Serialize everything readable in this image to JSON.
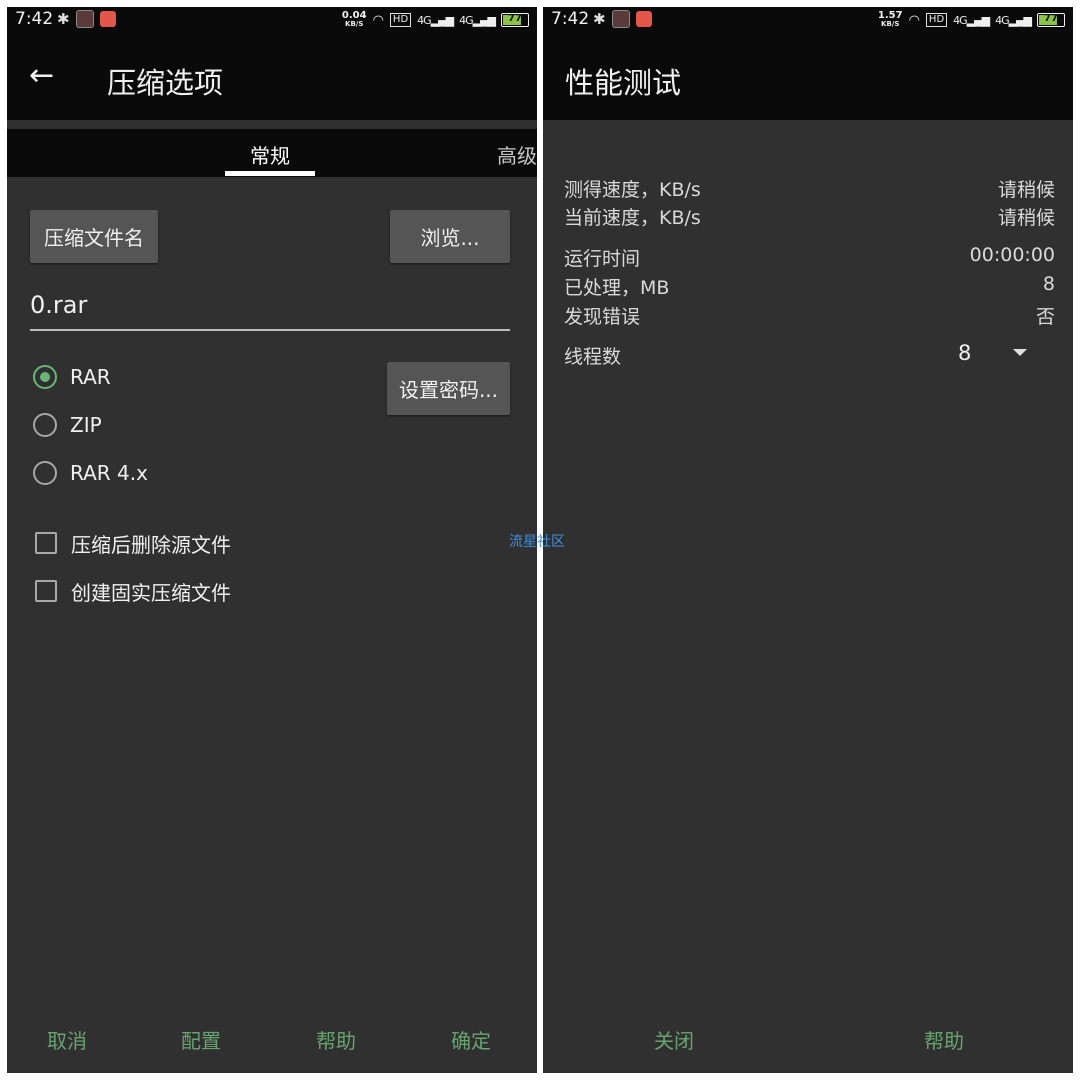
{
  "left": {
    "status": {
      "time": "7:42",
      "net_speed": "0.04",
      "net_unit": "KB/S",
      "sig1": "4G",
      "sig2": "4G",
      "hd": "HD",
      "battery": "77",
      "battery_level": 0.77
    },
    "title": "压缩选项",
    "tabs": [
      "常规",
      "高级"
    ],
    "archive_name_button": "压缩文件名",
    "browse_button": "浏览...",
    "filename_value": "0.rar",
    "formats": [
      "RAR",
      "ZIP",
      "RAR 4.x"
    ],
    "selected_format": "RAR",
    "set_password_button": "设置密码...",
    "options": [
      "压缩后删除源文件",
      "创建固实压缩文件"
    ],
    "footer": [
      "取消",
      "配置",
      "帮助",
      "确定"
    ]
  },
  "right": {
    "status": {
      "time": "7:42",
      "net_speed": "1.57",
      "net_unit": "KB/S",
      "sig1": "4G",
      "sig2": "4G",
      "hd": "HD",
      "battery": "77",
      "battery_level": 0.77
    },
    "title": "性能测试",
    "rows": [
      {
        "label": "测得速度，KB/s",
        "value": "请稍候"
      },
      {
        "label": "当前速度，KB/s",
        "value": "请稍候"
      },
      {
        "label": "运行时间",
        "value": "00:00:00"
      },
      {
        "label": "已处理，MB",
        "value": "8"
      },
      {
        "label": "发现错误",
        "value": "否"
      }
    ],
    "threads_label": "线程数",
    "threads_value": "8",
    "footer": [
      "关闭",
      "帮助"
    ]
  },
  "watermark": "流星社区",
  "colors": {
    "accent": "#67a36f",
    "panel_bg": "#303030",
    "bar_bg": "#0a0a0a",
    "button_bg": "#555555"
  }
}
